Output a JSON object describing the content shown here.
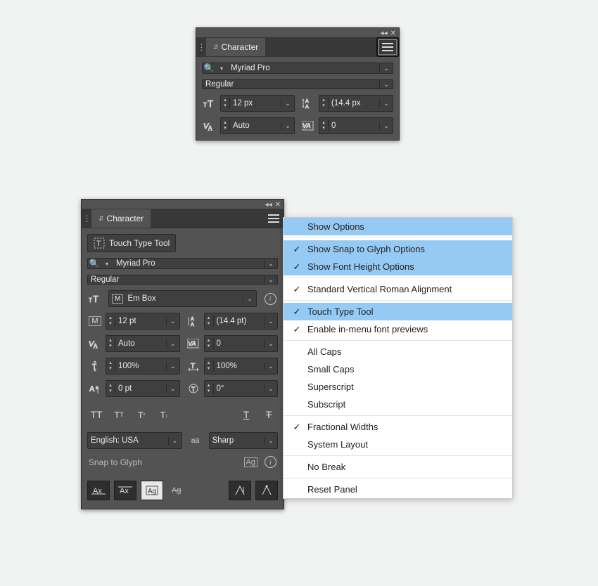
{
  "panel_small": {
    "title": "Character",
    "font_family": "Myriad Pro",
    "font_style": "Regular",
    "size": "12 px",
    "leading": "(14.4 px",
    "kerning": "Auto",
    "tracking": "0"
  },
  "panel_large": {
    "title": "Character",
    "touch_tool": "Touch Type Tool",
    "font_family": "Myriad Pro",
    "font_style": "Regular",
    "height_ref": "Em Box",
    "size": "12 pt",
    "leading": "(14.4 pt)",
    "kerning": "Auto",
    "tracking": "0",
    "v_scale": "100%",
    "h_scale": "100%",
    "baseline_shift": "0 pt",
    "rotation": "0°",
    "language": "English: USA",
    "antialias": "Sharp",
    "snap_label": "Snap to Glyph"
  },
  "flyout": {
    "items": [
      {
        "label": "Show Options",
        "checked": false,
        "highlight": true
      },
      {
        "sep": true
      },
      {
        "label": "Show Snap to Glyph Options",
        "checked": true,
        "highlight": true
      },
      {
        "label": "Show Font Height Options",
        "checked": true,
        "highlight": true
      },
      {
        "sep": true
      },
      {
        "label": "Standard Vertical Roman Alignment",
        "checked": true,
        "highlight": false
      },
      {
        "sep": true
      },
      {
        "label": "Touch Type Tool",
        "checked": true,
        "highlight": true
      },
      {
        "label": "Enable in-menu font previews",
        "checked": true,
        "highlight": false
      },
      {
        "sep": true
      },
      {
        "label": "All Caps",
        "checked": false,
        "highlight": false
      },
      {
        "label": "Small Caps",
        "checked": false,
        "highlight": false
      },
      {
        "label": "Superscript",
        "checked": false,
        "highlight": false
      },
      {
        "label": "Subscript",
        "checked": false,
        "highlight": false
      },
      {
        "sep": true
      },
      {
        "label": "Fractional Widths",
        "checked": true,
        "highlight": false
      },
      {
        "label": "System Layout",
        "checked": false,
        "highlight": false
      },
      {
        "sep": true
      },
      {
        "label": "No Break",
        "checked": false,
        "highlight": false
      },
      {
        "sep": true
      },
      {
        "label": "Reset Panel",
        "checked": false,
        "highlight": false
      }
    ]
  }
}
